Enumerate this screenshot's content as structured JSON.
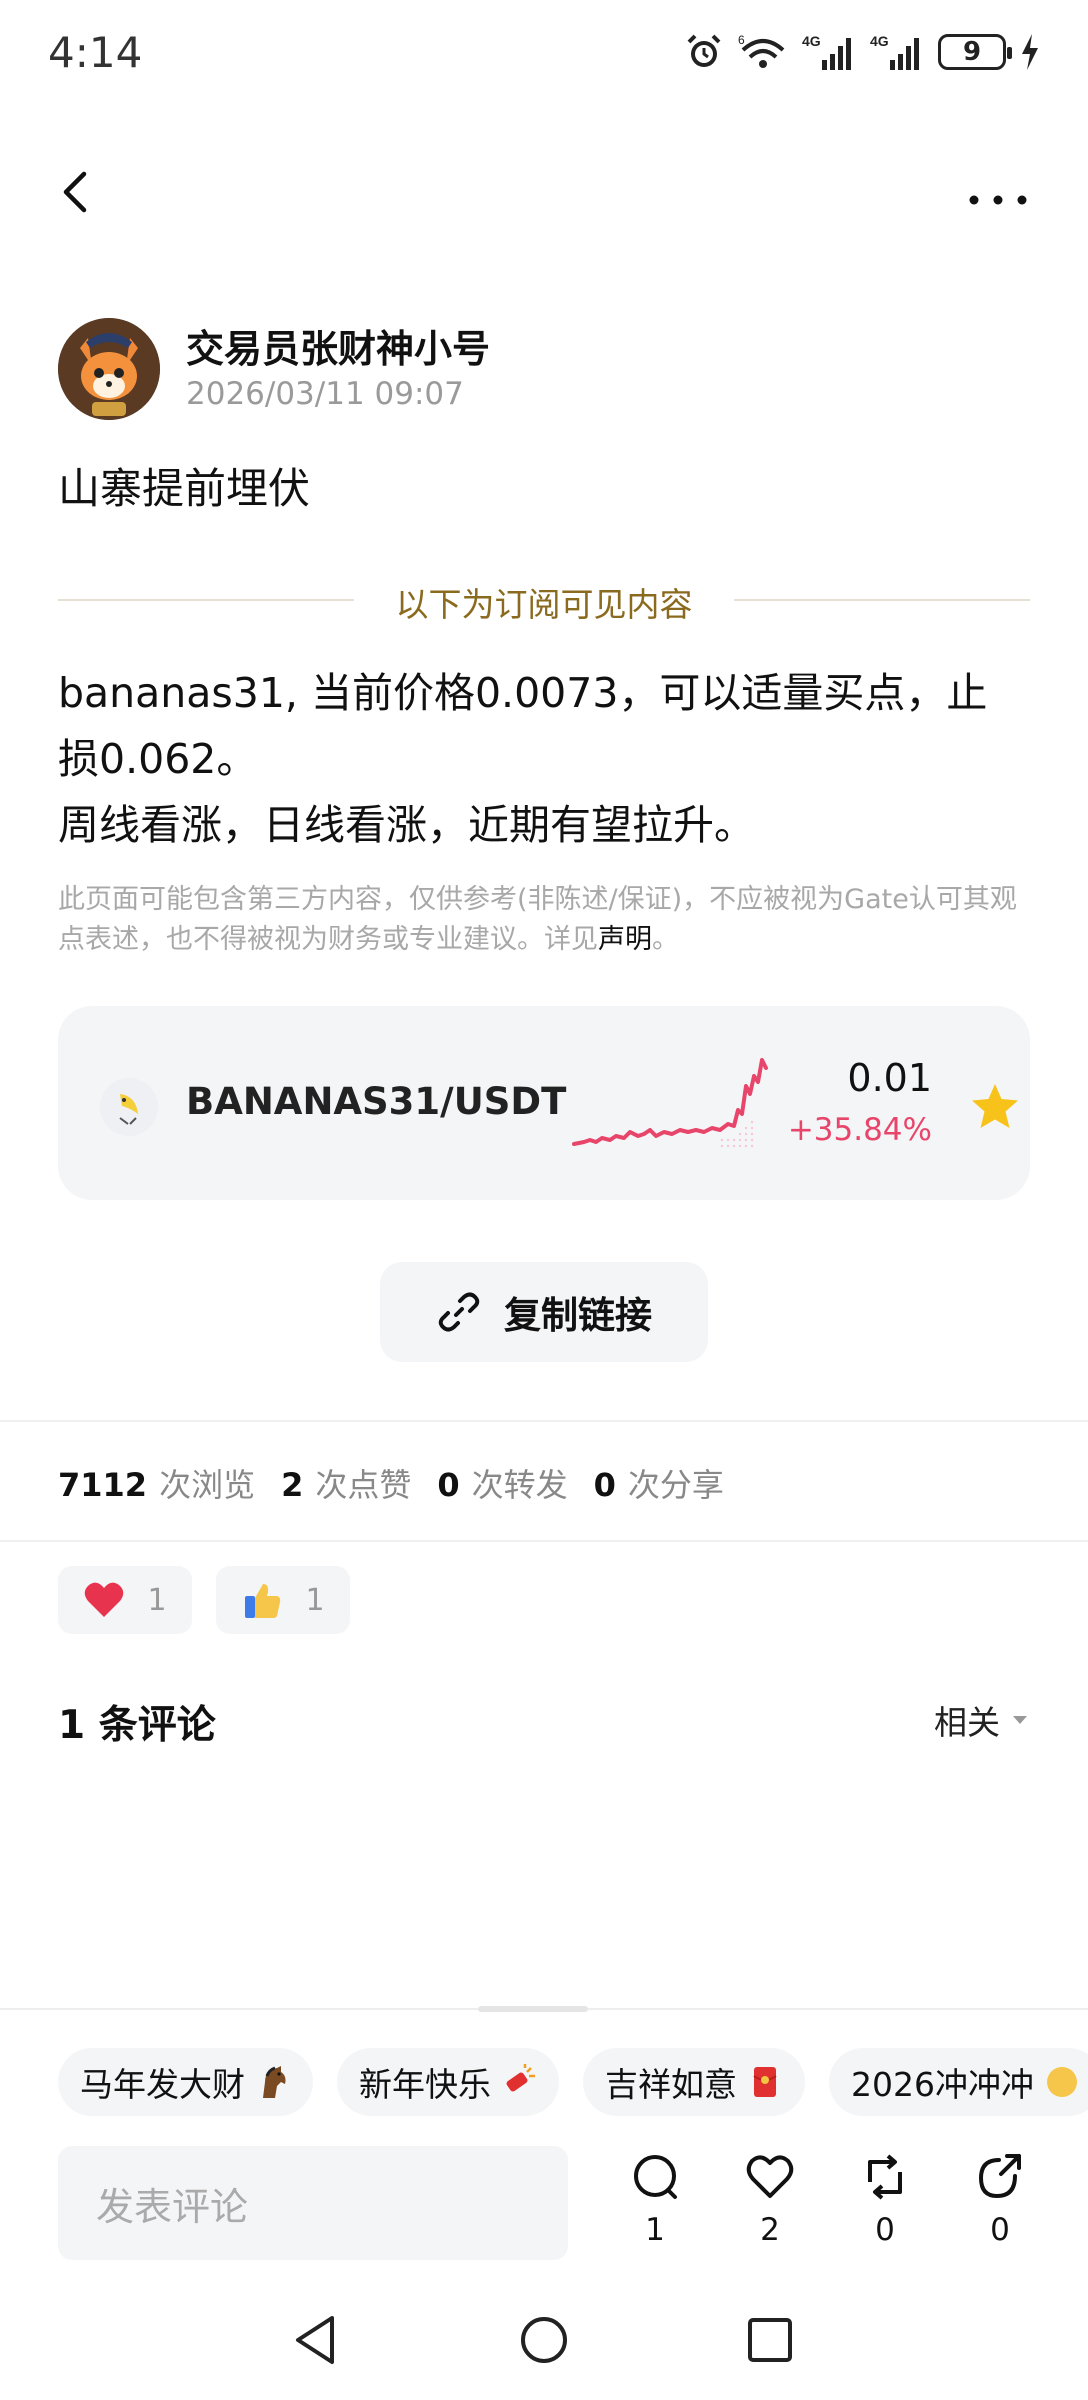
{
  "status_bar": {
    "time": "4:14",
    "battery": "9",
    "signal_labels": [
      "4G",
      "4G"
    ],
    "wifi_label": "6"
  },
  "nav": {
    "back_icon": "chevron-left-icon",
    "more_icon": "more-horizontal-icon"
  },
  "post": {
    "author_name": "交易员张财神小号",
    "date": "2026/03/11 09:07",
    "title": "山寨提前埋伏",
    "subscriber_divider": "以下为订阅可见内容",
    "body_lines": [
      "bananas31, 当前价格0.0073，可以适量买点，止",
      "损0.062。",
      "周线看涨，日线看涨，近期有望拉升。"
    ],
    "disclaimer_text": "此页面可能包含第三方内容，仅供参考(非陈述/保证)，不应被视为Gate认可其观点表述，也不得被视为财务或专业建议。详见",
    "disclaimer_link": "声明",
    "disclaimer_end": "。"
  },
  "market": {
    "pair": "BANANAS31/USDT",
    "price": "0.01",
    "change": "+35.84%",
    "change_color": "#e8456b",
    "favorite": true
  },
  "copy_link": {
    "label": "复制链接",
    "icon": "link-icon"
  },
  "stats": [
    {
      "num": "7112",
      "unit": "次浏览"
    },
    {
      "num": "2",
      "unit": "次点赞"
    },
    {
      "num": "0",
      "unit": "次转发"
    },
    {
      "num": "0",
      "unit": "次分享"
    }
  ],
  "reactions": [
    {
      "icon": "heart-icon",
      "count": "1"
    },
    {
      "icon": "thumbs-up-icon",
      "count": "1"
    }
  ],
  "comments": {
    "heading": "1 条评论",
    "sort_label": "相关"
  },
  "tags": [
    {
      "label": "马年发大财",
      "icon": "horse-icon"
    },
    {
      "label": "新年快乐",
      "icon": "firecracker-icon"
    },
    {
      "label": "吉祥如意",
      "icon": "red-envelope-icon"
    },
    {
      "label": "2026冲冲冲",
      "icon": "emoji-icon"
    }
  ],
  "comment_bar": {
    "placeholder": "发表评论",
    "actions": [
      {
        "icon": "comment-icon",
        "count": "1"
      },
      {
        "icon": "heart-outline-icon",
        "count": "2"
      },
      {
        "icon": "repost-icon",
        "count": "0"
      },
      {
        "icon": "share-icon",
        "count": "0"
      }
    ]
  },
  "colors": {
    "accent_gold": "#8a6a1e",
    "up_pink": "#e8456b",
    "star_yellow": "#f7c21a"
  }
}
